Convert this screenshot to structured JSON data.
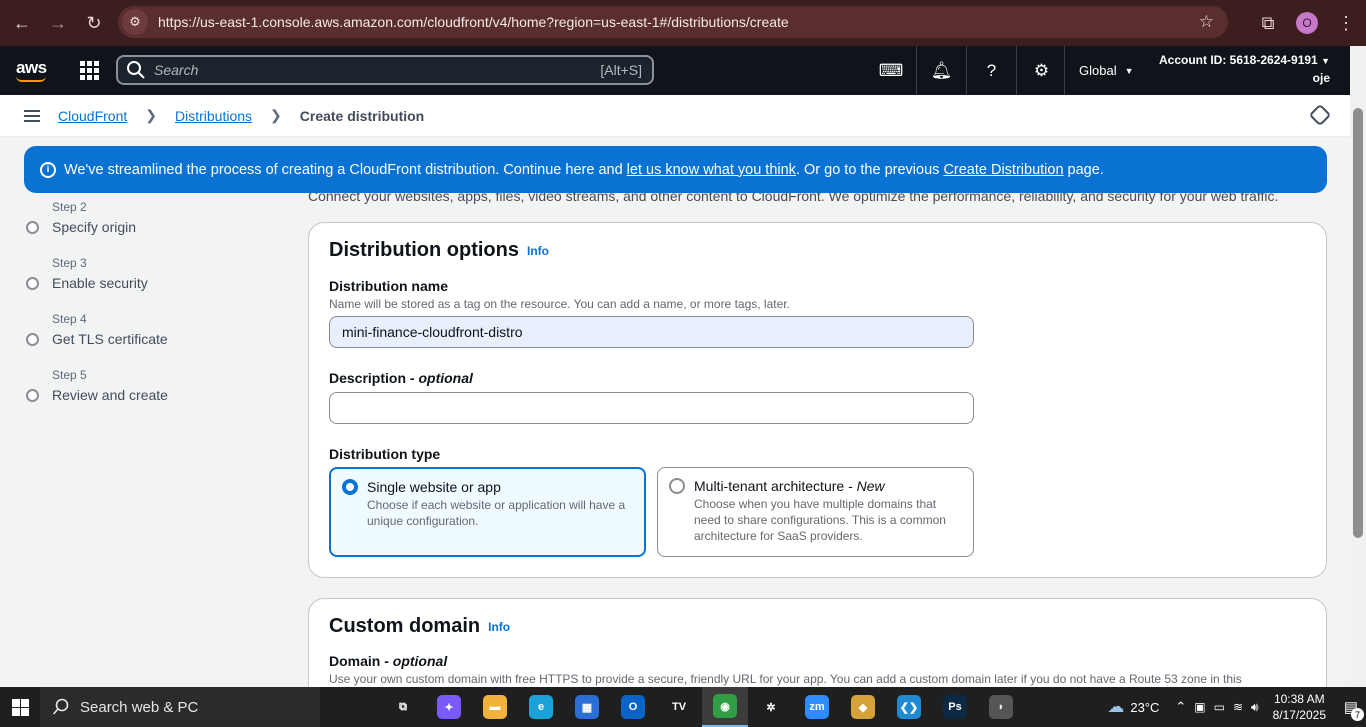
{
  "browser": {
    "url": "https://us-east-1.console.aws.amazon.com/cloudfront/v4/home?region=us-east-1#/distributions/create",
    "profile_initial": "O"
  },
  "aws_nav": {
    "logo": "aws",
    "search_placeholder": "Search",
    "search_shortcut": "[Alt+S]",
    "region": "Global",
    "account_id": "Account ID: 5618-2624-9191",
    "user": "oje"
  },
  "breadcrumb": {
    "items": [
      "CloudFront",
      "Distributions",
      "Create distribution"
    ]
  },
  "flash": {
    "text_before": "We've streamlined the process of creating a CloudFront distribution. Continue here and ",
    "link1": "let us know what you think",
    "text_middle": ". Or go to the previous ",
    "link2": "Create Distribution",
    "text_after": " page."
  },
  "steps": [
    {
      "num": "Step 2",
      "label": "Specify origin"
    },
    {
      "num": "Step 3",
      "label": "Enable security"
    },
    {
      "num": "Step 4",
      "label": "Get TLS certificate"
    },
    {
      "num": "Step 5",
      "label": "Review and create"
    }
  ],
  "intro": "Connect your websites, apps, files, video streams, and other content to CloudFront. We optimize the performance, reliability, and security for your web traffic.",
  "distribution_options": {
    "title": "Distribution options",
    "info": "Info",
    "name_label": "Distribution name",
    "name_desc": "Name will be stored as a tag on the resource. You can add a name, or more tags, later.",
    "name_value": "mini-finance-cloudfront-distro",
    "desc_label": "Description - ",
    "desc_optional": "optional",
    "desc_value": "",
    "type_label": "Distribution type",
    "types": [
      {
        "title": "Single website or app",
        "title_suffix": "",
        "desc": "Choose if each website or application will have a unique configuration.",
        "selected": true
      },
      {
        "title": "Multi-tenant architecture - ",
        "title_suffix": "New",
        "desc": "Choose when you have multiple domains that need to share configurations. This is a common architecture for SaaS providers.",
        "selected": false
      }
    ]
  },
  "custom_domain": {
    "title": "Custom domain",
    "info": "Info",
    "domain_label": "Domain - ",
    "domain_optional": "optional",
    "domain_desc": "Use your own custom domain with free HTTPS to provide a secure, friendly URL for your app. You can add a custom domain later if you do not have a Route 53 zone in this"
  },
  "taskbar": {
    "search": "Search web & PC",
    "weather": "23°C",
    "time": "10:38 AM",
    "date": "8/17/2025",
    "notifications": "7",
    "apps": [
      {
        "name": "task-view",
        "color": "#1f1f1f",
        "glyph": "⧉"
      },
      {
        "name": "copilot",
        "color": "#7a5af8",
        "glyph": "✦"
      },
      {
        "name": "file-explorer",
        "color": "#f2b33d",
        "glyph": "▬"
      },
      {
        "name": "edge",
        "color": "#1aa1d8",
        "glyph": "e"
      },
      {
        "name": "store",
        "color": "#2b6fd6",
        "glyph": "▦"
      },
      {
        "name": "outlook",
        "color": "#0a64c7",
        "glyph": "O"
      },
      {
        "name": "tradingview",
        "color": "#1f1f1f",
        "glyph": "TV"
      },
      {
        "name": "chrome",
        "color": "#2f9e44",
        "glyph": "◉"
      },
      {
        "name": "perplexity",
        "color": "#1f1f1f",
        "glyph": "✲"
      },
      {
        "name": "zoom",
        "color": "#2d8cff",
        "glyph": "zm"
      },
      {
        "name": "git",
        "color": "#d6a33a",
        "glyph": "◆"
      },
      {
        "name": "vscode",
        "color": "#1f8ad2",
        "glyph": "❮❯"
      },
      {
        "name": "photoshop",
        "color": "#0d2a45",
        "glyph": "Ps"
      },
      {
        "name": "game",
        "color": "#555555",
        "glyph": "◗"
      }
    ]
  }
}
